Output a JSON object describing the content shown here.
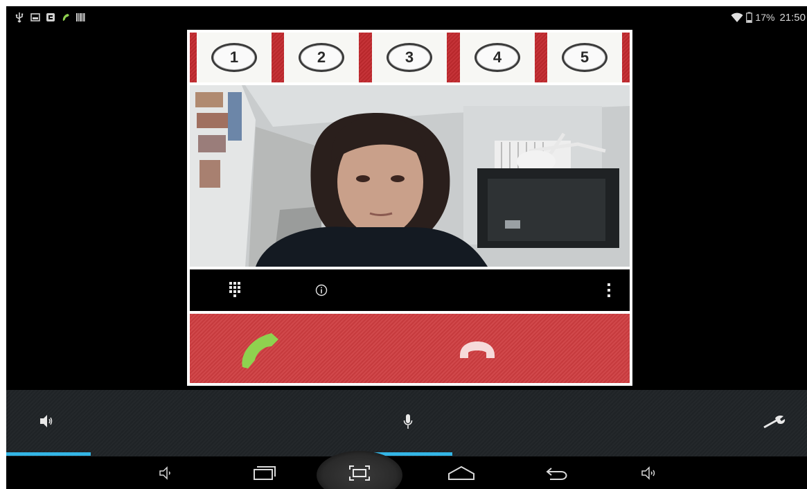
{
  "status_bar": {
    "battery_percent": "17%",
    "time": "21:50",
    "icons": [
      "usb-icon",
      "gallery-icon",
      "sim-icon",
      "call-icon",
      "barcode-icon",
      "wifi-icon",
      "battery-icon"
    ]
  },
  "speed_dial": {
    "buttons": [
      {
        "label": "1"
      },
      {
        "label": "2"
      },
      {
        "label": "3"
      },
      {
        "label": "4"
      },
      {
        "label": "5"
      }
    ]
  },
  "call_toolbar": {
    "icons": [
      "dialpad-icon",
      "info-icon",
      "overflow-menu-icon"
    ]
  },
  "call_actions": {
    "answer_icon": "phone-answer-icon",
    "hangup_icon": "phone-hangup-icon",
    "answer_color": "#8fd14f",
    "hangup_color": "#f3d2d2"
  },
  "control_bar": {
    "items": [
      {
        "name": "speaker",
        "icon": "speaker-icon",
        "active": true
      },
      {
        "name": "microphone",
        "icon": "microphone-icon",
        "active": true
      },
      {
        "name": "settings",
        "icon": "wrench-icon",
        "active": false
      }
    ],
    "accent_color": "#33b5e5"
  },
  "nav_bar": {
    "icons": [
      "volume-down-icon",
      "recent-apps-icon",
      "screenshot-icon",
      "home-icon",
      "back-icon",
      "volume-up-icon"
    ]
  }
}
